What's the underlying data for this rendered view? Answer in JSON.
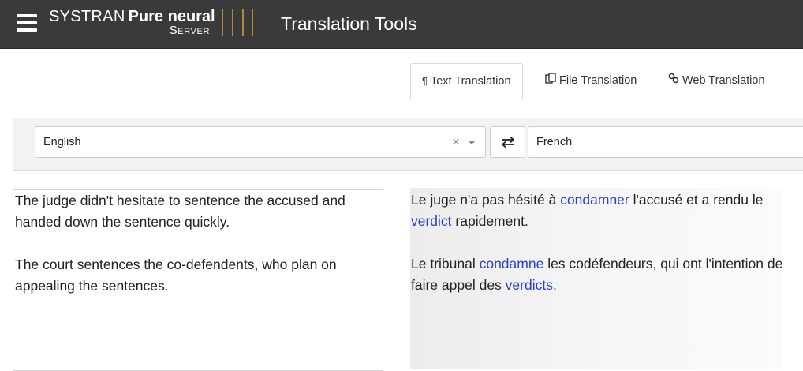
{
  "header": {
    "brand_line1_a": "SYSTRAN",
    "brand_line1_b": "Pure neural",
    "brand_line2": "Server",
    "app_title": "Translation Tools",
    "brand_accent": "#b08a3a",
    "background": "#3a3a3a"
  },
  "tabs": [
    {
      "label": "Text Translation",
      "icon": "paragraph-icon",
      "active": true
    },
    {
      "label": "File Translation",
      "icon": "files-icon",
      "active": false
    },
    {
      "label": "Web Translation",
      "icon": "link-icon",
      "active": false
    }
  ],
  "languages": {
    "source": "English",
    "target": "French",
    "clear_symbol": "×"
  },
  "source_text": {
    "p1": "The judge didn't hesitate to sentence the accused and handed down the sentence quickly.",
    "p2": "The court sentences the co-defendents, who plan on appealing the sentences."
  },
  "output_text": {
    "p1_a": "Le juge n'a pas hésité à ",
    "p1_w1": "condamner",
    "p1_b": " l'accusé et a rendu le ",
    "p1_w2": "verdict",
    "p1_c": " rapidement.",
    "p2_a": "Le tribunal ",
    "p2_w1": "condamne",
    "p2_b": " les codéfendeurs, qui ont l'intention de faire appel des ",
    "p2_w2": "verdicts",
    "p2_c": ".",
    "highlight_color": "#2a3fcf"
  }
}
